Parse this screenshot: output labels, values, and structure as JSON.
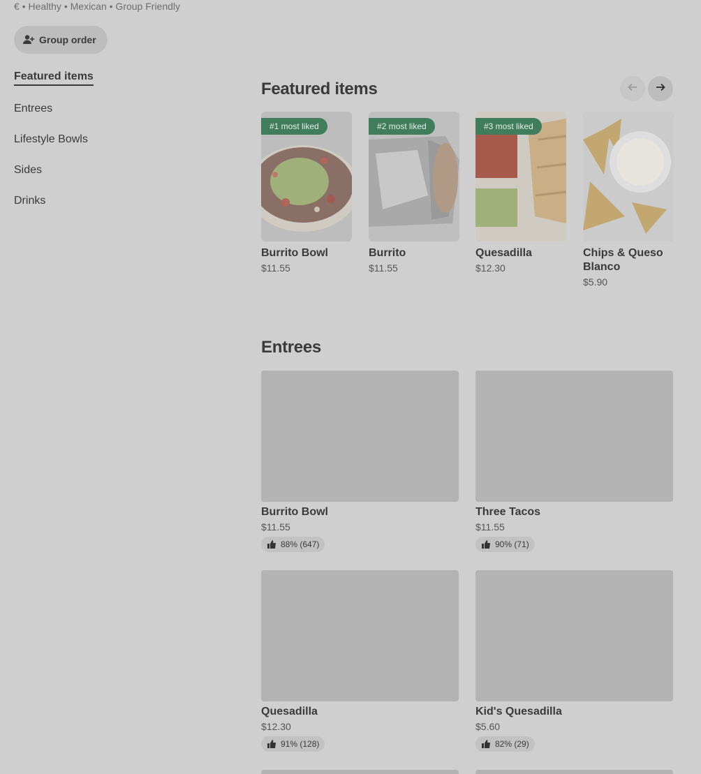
{
  "store": {
    "meta": "€ • Healthy • Mexican • Group Friendly",
    "group_order_label": "Group order"
  },
  "sidebar": {
    "items": [
      {
        "label": "Featured items",
        "active": true
      },
      {
        "label": "Entrees",
        "active": false
      },
      {
        "label": "Lifestyle Bowls",
        "active": false
      },
      {
        "label": "Sides",
        "active": false
      },
      {
        "label": "Drinks",
        "active": false
      }
    ]
  },
  "featured": {
    "title": "Featured items",
    "items": [
      {
        "badge": "#1 most liked",
        "name": "Burrito Bowl",
        "price": "$11.55",
        "image": "burrito-bowl-photo"
      },
      {
        "badge": "#2 most liked",
        "name": "Burrito",
        "price": "$11.55",
        "image": "burrito-photo"
      },
      {
        "badge": "#3 most liked",
        "name": "Quesadilla",
        "price": "$12.30",
        "image": "quesadilla-photo"
      },
      {
        "badge": "",
        "name": "Chips & Queso Blanco",
        "price": "$5.90",
        "image": "chips-queso-photo"
      }
    ]
  },
  "entrees": {
    "title": "Entrees",
    "items": [
      {
        "name": "Burrito Bowl",
        "price": "$11.55",
        "rating": "88% (647)"
      },
      {
        "name": "Three Tacos",
        "price": "$11.55",
        "rating": "90% (71)"
      },
      {
        "name": "Quesadilla",
        "price": "$12.30",
        "rating": "91% (128)"
      },
      {
        "name": "Kid's Quesadilla",
        "price": "$5.60",
        "rating": "82% (29)"
      }
    ]
  },
  "icons": {
    "group": "person-add-icon",
    "prev": "arrow-left-icon",
    "next": "arrow-right-icon",
    "rating": "thumbs-up-icon"
  },
  "colors": {
    "badge": "#3f7d5d",
    "overlay_background": "#cfcfcf"
  }
}
